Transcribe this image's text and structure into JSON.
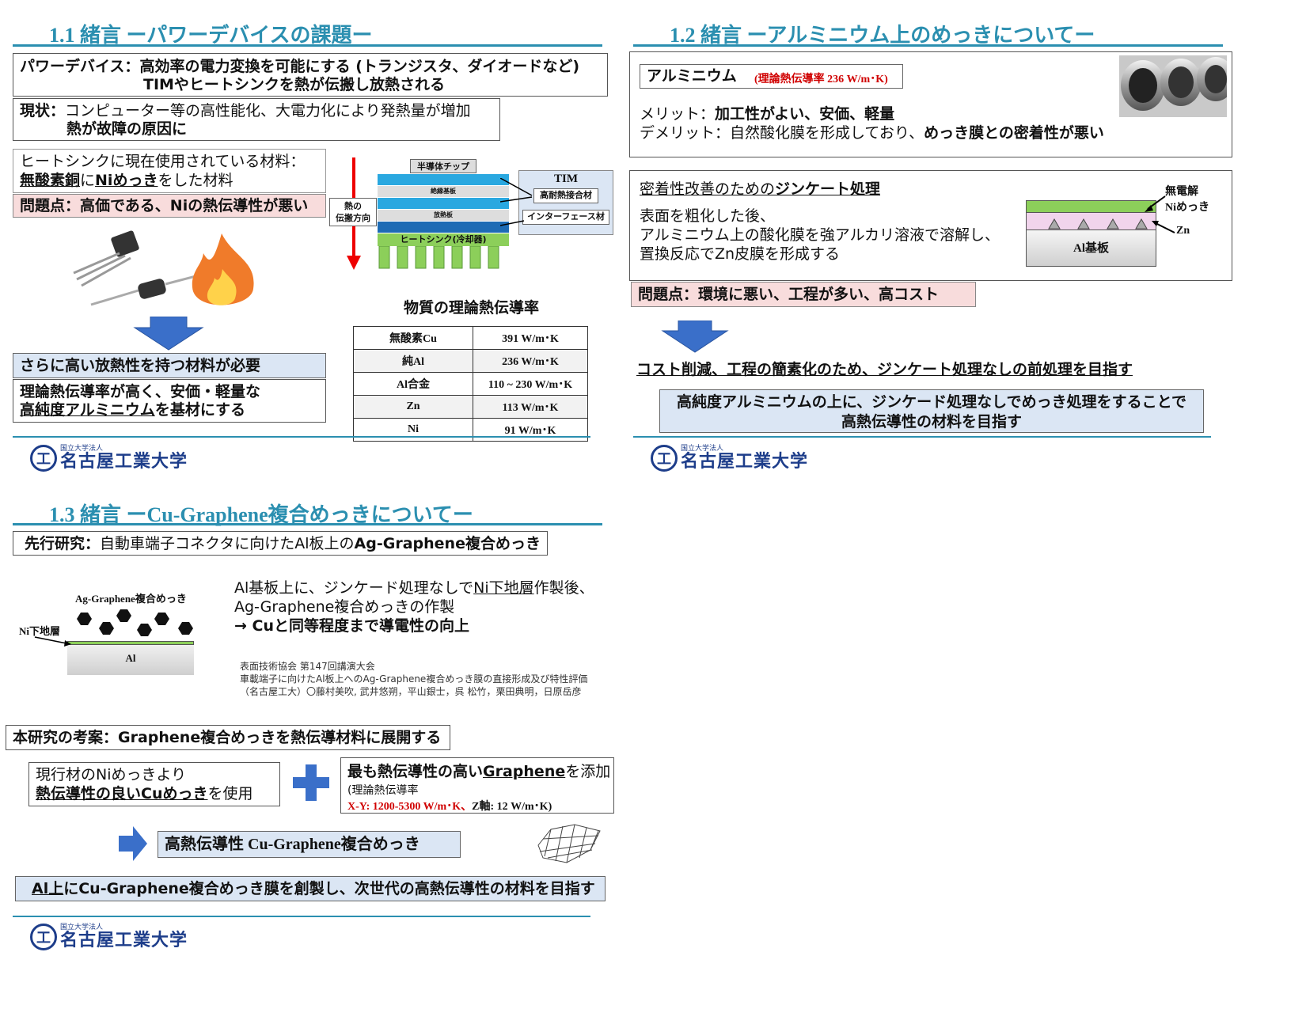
{
  "s1": {
    "title": "1.1 緒言 ーパワーデバイスの課題ー",
    "pd_label": "パワーデバイス：",
    "pd_text": "高効率の電力変換を可能にする (トランジスタ、ダイオードなど)",
    "pd_text2": "TIMやヒートシンクを熱が伝搬し放熱される",
    "now_label": "現状：",
    "now_text": "コンピューター等の高性能化、大電力化により発熱量が増加",
    "now_text2": "熱が故障の原因に",
    "hs_line1": "ヒートシンクに現在使用されている材料：",
    "hs_mat1": "無酸素銅",
    "hs_ni": "に",
    "hs_mat2": "Niめっき",
    "hs_tail": "をした材料",
    "problem": "問題点：高価である、Niの熱伝導性が悪い",
    "need": "さらに高い放熱性を持つ材料が必要",
    "base1": "理論熱伝導率が高く、安価・軽量な",
    "base2a": "高純度アルミニウム",
    "base2b": "を基材にする",
    "diagram": {
      "chip": "半導体チップ",
      "insul": "絶縁基板",
      "plate": "放熱板",
      "hs": "ヒートシンク(冷却器)",
      "tim": "TIM",
      "tim1": "高耐熱接合材",
      "tim2": "インターフェース材",
      "heat1": "熱の",
      "heat2": "伝搬方向"
    },
    "table_title": "物質の理論熱伝導率",
    "table": [
      [
        "無酸素Cu",
        "391 W/m･K"
      ],
      [
        "純Al",
        "236 W/m･K"
      ],
      [
        "Al合金",
        "110 ~ 230 W/m･K"
      ],
      [
        "Zn",
        "113 W/m･K"
      ],
      [
        "Ni",
        "91 W/m･K"
      ]
    ]
  },
  "s2": {
    "title": "1.2 緒言 ーアルミニウム上のめっきについてー",
    "al_label": "アルミニウム",
    "al_cond": "(理論熱伝導率 236 W/m･K)",
    "merit_label": "メリット：",
    "merit": "加工性がよい、安価、軽量",
    "demerit_label": "デメリット：自然酸化膜を形成しており、",
    "demerit": "めっき膜との密着性が悪い",
    "zinc_title_a": "密着性改善のための",
    "zinc_title_b": "ジンケート処理",
    "zinc1": "表面を粗化した後、",
    "zinc2": "アルミニウム上の酸化膜を強アルカリ溶液で溶解し、",
    "zinc3": "置換反応でZn皮膜を形成する",
    "lbl_ni1": "無電解",
    "lbl_ni2": "Niめっき",
    "lbl_zn": "Zn",
    "lbl_al": "Al基板",
    "problem": "問題点：環境に悪い、工程が多い、高コスト",
    "goal": "コスト削減、工程の簡素化のため、ジンケート処理なしの前処理を目指す",
    "final1": "高純度アルミニウムの上に、ジンケード処理なしでめっき処理をすることで",
    "final2": "高熱伝導性の材料を目指す"
  },
  "s3": {
    "title": "1.3 緒言 ーCu-Graphene複合めっきについてー",
    "prior_label": "先行研究：",
    "prior_text": "自動車端子コネクタに向けたAl板上の",
    "prior_bold": "Ag-Graphene複合めっき",
    "fig_top": "Ag-Graphene複合めっき",
    "fig_ni": "Ni下地層",
    "fig_al": "Al",
    "desc1a": "Al基板上に、ジンケード処理なしで",
    "desc1b": "Ni下地層",
    "desc1c": "作製後、",
    "desc2": "Ag-Graphene複合めっきの作製",
    "desc3": "→ Cuと同等程度まで導電性の向上",
    "ref1": "表面技術協会 第147回講演大会",
    "ref2": "車載端子に向けたAl板上へのAg-Graphene複合めっき膜の直接形成及び特性評価",
    "ref3": "（名古屋工大）〇藤村美吹, 武井悠朔，平山銀士，呉 松竹，栗田典明，日原岳彦",
    "idea": "本研究の考案：Graphene複合めっきを熱伝導材料に展開する",
    "cur1": "現行材のNiめっきより",
    "cur2a": "熱伝導性の良いCuめっき",
    "cur2b": "を使用",
    "gr1a": "最も熱伝導性の高い",
    "gr1b": "Graphene",
    "gr1c": "を添加",
    "gr2": "(理論熱伝導率",
    "gr3a": "X-Y: 1200-5300 W/m･K、",
    "gr3b": "Z軸: 12 W/m･K)",
    "result": "高熱伝導性 Cu-Graphene複合めっき",
    "final_a": "Al上",
    "final_b": "にCu-Graphene複合めっき膜を創製し、次世代の高熱伝導性の材料を目指す"
  },
  "logo": {
    "small": "国立大学法人",
    "big": "名古屋工業大学",
    "mark": "工"
  },
  "colors": {
    "accent": "#2b8fb0",
    "pink": "#f8dcdc",
    "lightblue": "#dbe6f4",
    "arrow": "#3a6fc9",
    "red": "#d00000"
  }
}
